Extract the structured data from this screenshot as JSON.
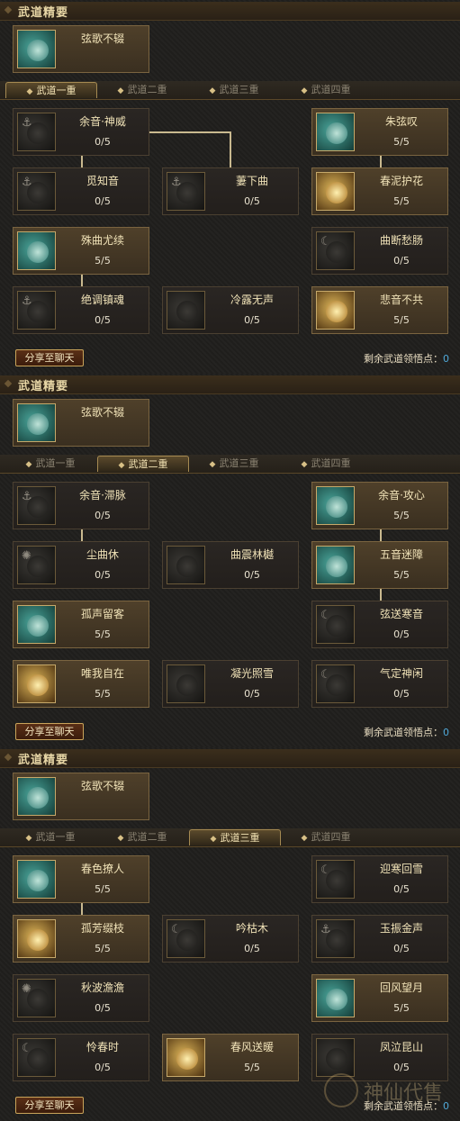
{
  "panels": [
    {
      "header": "武道精要",
      "essence": {
        "name": "弦歌不辍"
      },
      "tabs": [
        "武道一重",
        "武道二重",
        "武道三重",
        "武道四重"
      ],
      "active_tab": 0,
      "nodes": [
        {
          "name": "余音·神威",
          "points": "0/5"
        },
        {
          "name": "朱弦叹",
          "points": "5/5"
        },
        {
          "name": "觅知音",
          "points": "0/5"
        },
        {
          "name": "萋下曲",
          "points": "0/5"
        },
        {
          "name": "春泥护花",
          "points": "5/5"
        },
        {
          "name": "殊曲尤续",
          "points": "5/5"
        },
        {
          "name": "曲断愁肠",
          "points": "0/5"
        },
        {
          "name": "绝调镇魂",
          "points": "0/5"
        },
        {
          "name": "冷露无声",
          "points": "0/5"
        },
        {
          "name": "悲音不共",
          "points": "5/5"
        }
      ],
      "share_label": "分享至聊天",
      "remain_label": "剩余武道领悟点：",
      "remain_value": "0"
    },
    {
      "header": "武道精要",
      "essence": {
        "name": "弦歌不辍"
      },
      "tabs": [
        "武道一重",
        "武道二重",
        "武道三重",
        "武道四重"
      ],
      "active_tab": 1,
      "nodes": [
        {
          "name": "余音·滞脉",
          "points": "0/5"
        },
        {
          "name": "余音·攻心",
          "points": "5/5"
        },
        {
          "name": "尘曲休",
          "points": "0/5"
        },
        {
          "name": "曲震林樾",
          "points": "0/5"
        },
        {
          "name": "五音迷障",
          "points": "5/5"
        },
        {
          "name": "孤声留客",
          "points": "5/5"
        },
        {
          "name": "弦送寒音",
          "points": "0/5"
        },
        {
          "name": "唯我自在",
          "points": "5/5"
        },
        {
          "name": "凝光照雪",
          "points": "0/5"
        },
        {
          "name": "气定神闲",
          "points": "0/5"
        }
      ],
      "share_label": "分享至聊天",
      "remain_label": "剩余武道领悟点：",
      "remain_value": "0"
    },
    {
      "header": "武道精要",
      "essence": {
        "name": "弦歌不辍"
      },
      "tabs": [
        "武道一重",
        "武道二重",
        "武道三重",
        "武道四重"
      ],
      "active_tab": 2,
      "nodes": [
        {
          "name": "春色撩人",
          "points": "5/5"
        },
        {
          "name": "迎寒回雪",
          "points": "0/5"
        },
        {
          "name": "孤芳缀枝",
          "points": "5/5"
        },
        {
          "name": "吟枯木",
          "points": "0/5"
        },
        {
          "name": "玉振金声",
          "points": "0/5"
        },
        {
          "name": "秋波澹澹",
          "points": "0/5"
        },
        {
          "name": "回风望月",
          "points": "5/5"
        },
        {
          "name": "怜春时",
          "points": "0/5"
        },
        {
          "name": "春风送暖",
          "points": "5/5"
        },
        {
          "name": "凤泣昆山",
          "points": "0/5"
        }
      ],
      "share_label": "分享至聊天",
      "remain_label": "剩余武道领悟点：",
      "remain_value": "0"
    }
  ],
  "watermark": "神仙代售"
}
